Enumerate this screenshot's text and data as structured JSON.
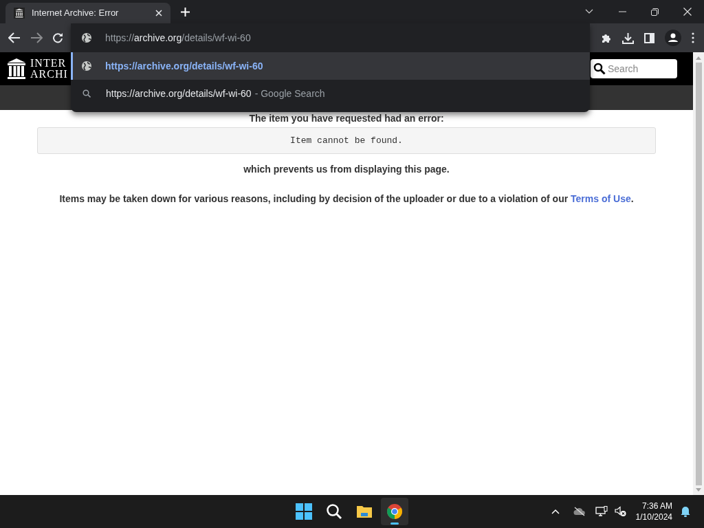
{
  "browser": {
    "tab": {
      "title": "Internet Archive: Error",
      "selected": true
    },
    "omnibox": {
      "scheme": "https://",
      "host": "archive.org",
      "path": "/details/wf-wi-60"
    },
    "suggestions": [
      {
        "kind": "url",
        "text": "https://archive.org/details/wf-wi-60",
        "selected": true
      },
      {
        "kind": "search",
        "text": "https://archive.org/details/wf-wi-60",
        "suffix": "- Google Search",
        "selected": false
      }
    ]
  },
  "page": {
    "logo_lines": [
      "INTER",
      "ARCHI"
    ],
    "search": {
      "placeholder": "Search"
    },
    "heading": "The item you have requested had an error:",
    "error_message": "Item cannot be found.",
    "explanation": "which prevents us from displaying this page.",
    "notice": {
      "text": "Items may be taken down for various reasons, including by decision of the uploader or due to a violation of our",
      "link": "Terms of Use",
      "end": "."
    }
  },
  "taskbar": {
    "apps": [
      {
        "kind": "start",
        "selected": false
      },
      {
        "kind": "search",
        "selected": false
      },
      {
        "kind": "files",
        "selected": false
      },
      {
        "kind": "chrome",
        "selected": true
      }
    ],
    "time": "7:36 AM",
    "date": "1/10/2024"
  }
}
